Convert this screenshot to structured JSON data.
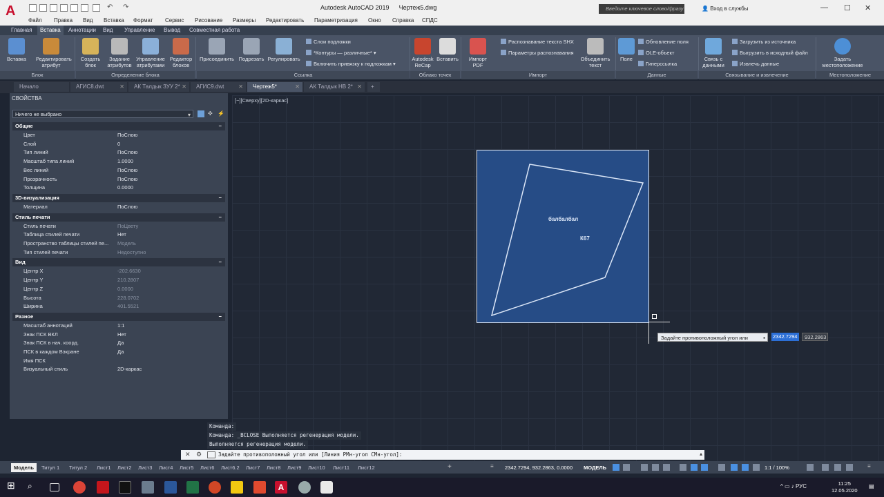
{
  "app": {
    "title": "Autodesk AutoCAD 2019",
    "file": "Чертеж5.dwg",
    "search_placeholder": "Введите ключевое слово/фразу",
    "signin": "Вход в службы"
  },
  "menu": [
    "Файл",
    "Правка",
    "Вид",
    "Вставка",
    "Формат",
    "Сервис",
    "Рисование",
    "Размеры",
    "Редактировать",
    "Параметризация",
    "Окно",
    "Справка",
    "СПДС"
  ],
  "ribbon_tabs": [
    "Главная",
    "Вставка",
    "Аннотации",
    "Вид",
    "Управление",
    "Вывод",
    "Совместная работа"
  ],
  "active_ribbon_tab": "Вставка",
  "ribbon": {
    "block_panel": {
      "title": "Блок",
      "buttons": [
        "Вставка",
        "Редактировать атрибут"
      ]
    },
    "blockdef_panel": {
      "title": "Определение блока",
      "buttons": [
        "Создать блок",
        "Задание атрибутов",
        "Управление атрибутами",
        "Редактор блоков"
      ]
    },
    "ref_panel": {
      "title": "Ссылка",
      "buttons": [
        "Присоединить",
        "Подрезать",
        "Регулировать"
      ],
      "small": [
        "Слои подложки",
        "*Контуры — различные*",
        "Включить привязку к подложкам"
      ]
    },
    "cloud_panel": {
      "title": "Облако точек",
      "buttons": [
        "Autodesk ReCap",
        "Вставить"
      ]
    },
    "import_panel": {
      "title": "Импорт",
      "buttons": [
        "Импорт PDF",
        "Объединить текст"
      ],
      "small": [
        "Распознавание текста SHX",
        "Параметры распознавания"
      ]
    },
    "data_panel": {
      "title": "Данные",
      "buttons": [
        "Поле"
      ],
      "small": [
        "Обновление поля",
        "OLE-объект",
        "Гиперссылка"
      ]
    },
    "link_panel": {
      "title": "Связывание и извлечение",
      "buttons": [
        "Связь с данными"
      ],
      "small": [
        "Загрузить из источника",
        "Выгрузить в исходный файл",
        "Извлечь данные"
      ]
    },
    "loc_panel": {
      "title": "Местоположение",
      "buttons": [
        "Задать местоположение"
      ]
    }
  },
  "doc_tabs": [
    "Начало",
    "АГИС8.dwt",
    "АК Талдык ЗУУ 2*",
    "АГИС9.dwt",
    "Чертеж5*",
    "АК Талдык НВ 2*"
  ],
  "active_doc_tab": "Чертеж5*",
  "properties": {
    "title": "СВОЙСТВА",
    "selection": "Ничего не выбрано",
    "sections": [
      {
        "name": "Общие",
        "rows": [
          {
            "k": "Цвет",
            "v": "ПоСлою"
          },
          {
            "k": "Слой",
            "v": "0"
          },
          {
            "k": "Тип линий",
            "v": "ПоСлою"
          },
          {
            "k": "Масштаб типа линий",
            "v": "1.0000"
          },
          {
            "k": "Вес линий",
            "v": "ПоСлою"
          },
          {
            "k": "Прозрачность",
            "v": "ПоСлою"
          },
          {
            "k": "Толщина",
            "v": "0.0000"
          }
        ]
      },
      {
        "name": "3D-визуализация",
        "rows": [
          {
            "k": "Материал",
            "v": "ПоСлою"
          }
        ]
      },
      {
        "name": "Стиль печати",
        "rows": [
          {
            "k": "Стиль печати",
            "v": "ПоЦвету"
          },
          {
            "k": "Таблица стилей печати",
            "v": "Нет"
          },
          {
            "k": "Пространство таблицы стилей пе...",
            "v": "Модель"
          },
          {
            "k": "Тип стилей печати",
            "v": "Недоступно"
          }
        ]
      },
      {
        "name": "Вид",
        "rows": [
          {
            "k": "Центр X",
            "v": "-202.6630"
          },
          {
            "k": "Центр Y",
            "v": "210.2807"
          },
          {
            "k": "Центр Z",
            "v": "0.0000"
          },
          {
            "k": "Высота",
            "v": "228.0702"
          },
          {
            "k": "Ширина",
            "v": "401.5521"
          }
        ]
      },
      {
        "name": "Разное",
        "rows": [
          {
            "k": "Масштаб аннотаций",
            "v": "1:1"
          },
          {
            "k": "Знак ПСК ВКЛ",
            "v": "Нет"
          },
          {
            "k": "Знак ПСК в нач. коорд.",
            "v": "Да"
          },
          {
            "k": "ПСК в каждом Вэкране",
            "v": "Да"
          },
          {
            "k": "Имя ПСК",
            "v": ""
          },
          {
            "k": "Визуальный стиль",
            "v": "2D-каркас"
          }
        ]
      }
    ]
  },
  "viewport": {
    "label": "[−][Сверху][2D-каркас]",
    "text1": "балбалбал",
    "text2": "К67",
    "tooltip": "Задайте противоположный угол или",
    "input1": "2342.7294",
    "input2": "932.2863"
  },
  "command": {
    "history": [
      "Команда:",
      "Команда:  _BCLOSE Выполняется регенерация модели.",
      "Выполняется регенерация модели."
    ],
    "prompt": "Задайте противоположный угол или [Линия РМн-угол СМн-угол]:"
  },
  "layout_tabs": [
    "Модель",
    "Титул 1",
    "Титул 2",
    "Лист1",
    "Лист2",
    "Лист3",
    "Лист4",
    "Лист5",
    "Лист6",
    "Лист6.2",
    "Лист7",
    "Лист8",
    "Лист9",
    "Лист10",
    "Лист11",
    "Лист12"
  ],
  "status": {
    "coords": "2342.7294, 932.2863, 0.0000",
    "mode": "МОДЕЛЬ",
    "scale": "1:1 / 100%"
  },
  "taskbar": {
    "lang": "РУС",
    "time": "11:25",
    "date": "12.05.2020"
  }
}
